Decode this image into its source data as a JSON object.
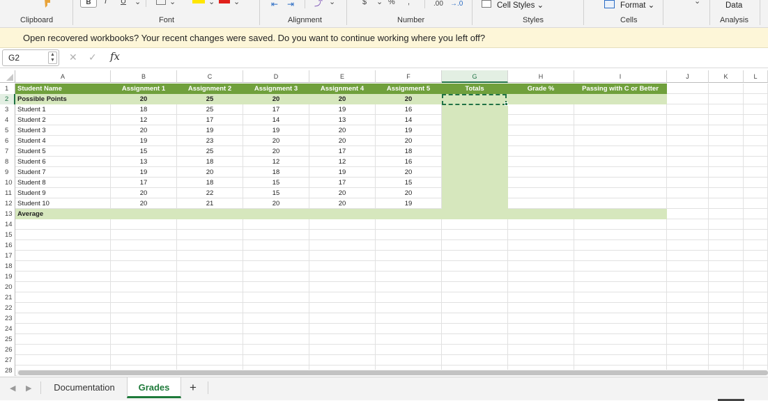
{
  "ribbon": {
    "groups": [
      "Clipboard",
      "Font",
      "Alignment",
      "Number",
      "Styles",
      "Cells",
      "Analysis"
    ],
    "cell_styles_label": "Cell Styles",
    "format_label": "Format",
    "data_label": "Data",
    "decimal_label": ".00",
    "decimal_arrow": "→.0",
    "bold_label": "B",
    "italic_label": "I",
    "underline_label": "U"
  },
  "recovery": {
    "message": "Open recovered workbooks?  Your recent changes were saved. Do you want to continue working where you left off?"
  },
  "formula_bar": {
    "name_box": "G2",
    "fx": "fx",
    "cancel_icon": "✕",
    "enter_icon": "✓",
    "value": ""
  },
  "sheet": {
    "columns": [
      "A",
      "B",
      "C",
      "D",
      "E",
      "F",
      "G",
      "H",
      "I",
      "J",
      "K",
      "L"
    ],
    "selected_column": "G",
    "selected_row": 2,
    "row_numbers": [
      "1",
      "2",
      "3",
      "4",
      "5",
      "6",
      "7",
      "8",
      "9",
      "10",
      "11",
      "12",
      "13",
      "14",
      "15",
      "16",
      "17",
      "18",
      "19",
      "20",
      "21",
      "22",
      "23",
      "24",
      "25",
      "26",
      "27",
      "28"
    ],
    "header_row": [
      "Student Name",
      "Assignment 1",
      "Assignment 2",
      "Assignment 3",
      "Assignment 4",
      "Assignment 5",
      "Totals",
      "Grade %",
      "Passing with C or Better"
    ],
    "possible_points": {
      "label": "Possible Points",
      "values": [
        "20",
        "25",
        "20",
        "20",
        "20"
      ]
    },
    "students": [
      {
        "name": "Student 1",
        "scores": [
          "18",
          "25",
          "17",
          "19",
          "16"
        ]
      },
      {
        "name": "Student 2",
        "scores": [
          "12",
          "17",
          "14",
          "13",
          "14"
        ]
      },
      {
        "name": "Student 3",
        "scores": [
          "20",
          "19",
          "19",
          "20",
          "19"
        ]
      },
      {
        "name": "Student 4",
        "scores": [
          "19",
          "23",
          "20",
          "20",
          "20"
        ]
      },
      {
        "name": "Student 5",
        "scores": [
          "15",
          "25",
          "20",
          "17",
          "18"
        ]
      },
      {
        "name": "Student 6",
        "scores": [
          "13",
          "18",
          "12",
          "12",
          "16"
        ]
      },
      {
        "name": "Student 7",
        "scores": [
          "19",
          "20",
          "18",
          "19",
          "20"
        ]
      },
      {
        "name": "Student 8",
        "scores": [
          "17",
          "18",
          "15",
          "17",
          "15"
        ]
      },
      {
        "name": "Student 9",
        "scores": [
          "20",
          "22",
          "15",
          "20",
          "20"
        ]
      },
      {
        "name": "Student 10",
        "scores": [
          "20",
          "21",
          "20",
          "20",
          "19"
        ]
      }
    ],
    "average_label": "Average"
  },
  "tabs": {
    "items": [
      "Documentation",
      "Grades"
    ],
    "active": "Grades",
    "add_label": "+"
  },
  "colors": {
    "header_green": "#70a03c",
    "light_green": "#d6e7bd",
    "accent": "#217346",
    "recovery_bg": "#fdf6d8"
  }
}
